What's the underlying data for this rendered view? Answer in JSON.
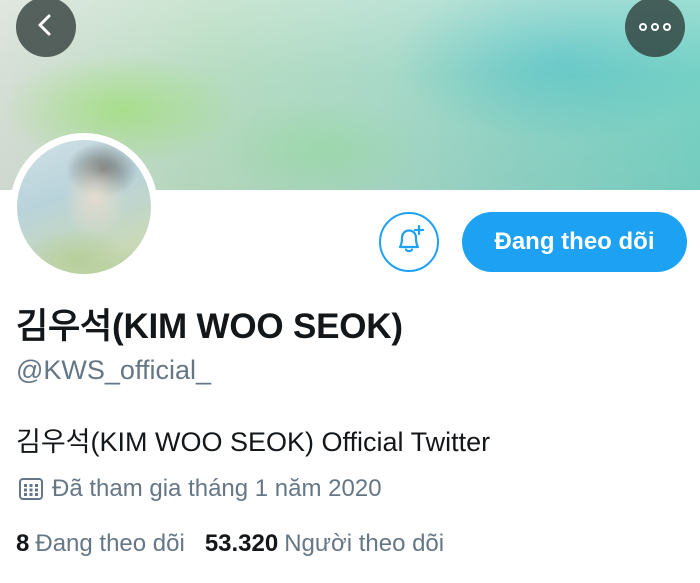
{
  "header": {
    "back_icon": "chevron-left-icon",
    "more_icon": "more-options-icon",
    "banner_colors": [
      "#d6dfd6",
      "#a8d9c7",
      "#78d2c4"
    ]
  },
  "profile": {
    "avatar_icon": "profile-photo",
    "display_name": "김우석(KIM WOO SEOK)",
    "handle": "@KWS_official_",
    "bio": "김우석(KIM WOO SEOK) Official Twitter",
    "joined_icon": "calendar-icon",
    "joined": "Đã tham gia tháng 1 năm 2020"
  },
  "actions": {
    "notify_icon": "bell-plus-icon",
    "follow_label": "Đang theo dõi",
    "accent_color": "#1da1f2"
  },
  "stats": {
    "following_count": "8",
    "following_label": "Đang theo dõi",
    "followers_count": "53.320",
    "followers_label": "Người theo dõi"
  }
}
